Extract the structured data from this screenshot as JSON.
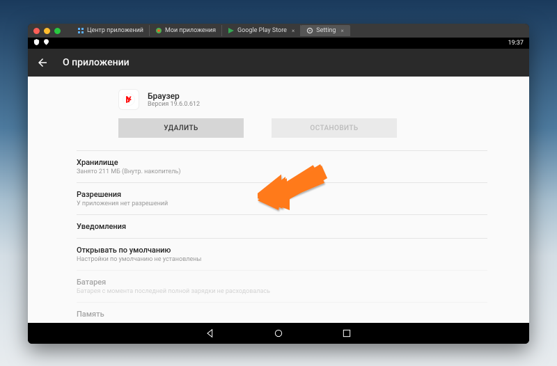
{
  "window": {
    "tabs": [
      {
        "label": "Центр приложений"
      },
      {
        "label": "Мои приложения"
      },
      {
        "label": "Google Play Store"
      },
      {
        "label": "Setting"
      }
    ]
  },
  "statusbar": {
    "time": "19:37"
  },
  "header": {
    "title": "О приложении"
  },
  "app": {
    "name": "Браузер",
    "version": "Версия 19.6.0.612",
    "buttons": {
      "uninstall": "УДАЛИТЬ",
      "stop": "ОСТАНОВИТЬ"
    }
  },
  "sections": {
    "storage": {
      "title": "Хранилище",
      "subtitle": "Занято 211 МБ (Внутр. накопитель)"
    },
    "permissions": {
      "title": "Разрешения",
      "subtitle": "У приложения нет разрешений"
    },
    "notifications": {
      "title": "Уведомления",
      "subtitle": ""
    },
    "default": {
      "title": "Открывать по умолчанию",
      "subtitle": "Настройки по умолчанию не установлены"
    },
    "battery": {
      "title": "Батарея",
      "subtitle": "Батарея с момента последней полной зарядки не расходовалась"
    },
    "memory": {
      "title": "Память",
      "subtitle": ""
    }
  }
}
